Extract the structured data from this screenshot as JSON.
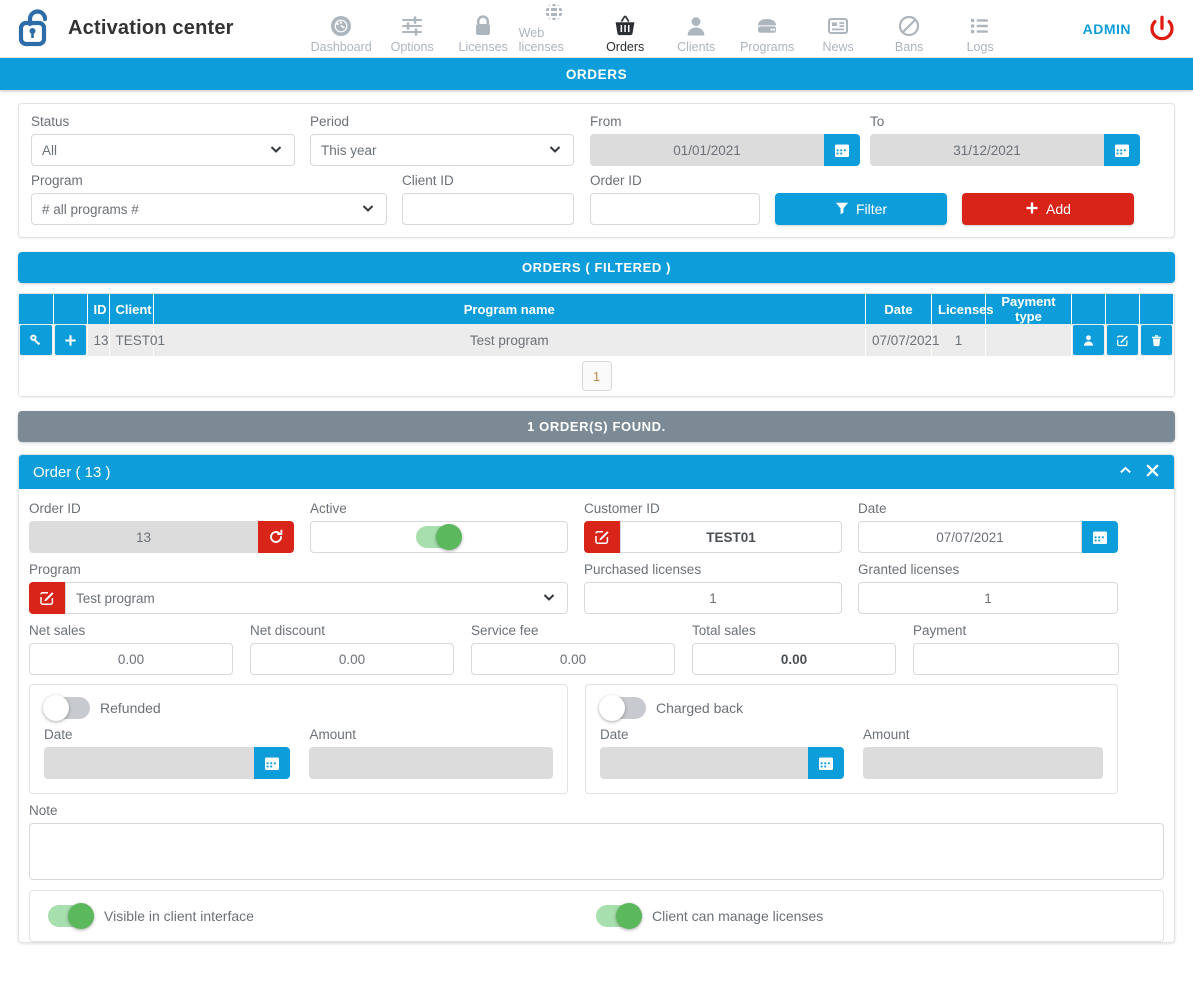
{
  "app": {
    "title": "Activation center",
    "logo_icon": "open-padlock-icon",
    "admin_label": "ADMIN",
    "power_icon": "power-icon"
  },
  "nav": {
    "items": [
      {
        "label": "Dashboard",
        "icon": "dashboard-gauge-icon",
        "active": false
      },
      {
        "label": "Options",
        "icon": "sliders-icon",
        "active": false
      },
      {
        "label": "Licenses",
        "icon": "lock-icon",
        "active": false
      },
      {
        "label": "Web licenses",
        "icon": "globe-icon",
        "active": false
      },
      {
        "label": "Orders",
        "icon": "basket-icon",
        "active": true
      },
      {
        "label": "Clients",
        "icon": "user-icon",
        "active": false
      },
      {
        "label": "Programs",
        "icon": "server-icon",
        "active": false
      },
      {
        "label": "News",
        "icon": "newspaper-icon",
        "active": false
      },
      {
        "label": "Bans",
        "icon": "ban-icon",
        "active": false
      },
      {
        "label": "Logs",
        "icon": "list-icon",
        "active": false
      }
    ]
  },
  "page_banner": {
    "title": "ORDERS"
  },
  "filters": {
    "status": {
      "label": "Status",
      "value": "All"
    },
    "period": {
      "label": "Period",
      "value": "This year"
    },
    "from": {
      "label": "From",
      "value": "01/01/2021",
      "calendar_icon": "calendar-icon"
    },
    "to": {
      "label": "To",
      "value": "31/12/2021",
      "calendar_icon": "calendar-icon"
    },
    "program": {
      "label": "Program",
      "value": "# all programs #"
    },
    "client_id": {
      "label": "Client ID",
      "value": ""
    },
    "order_id": {
      "label": "Order ID",
      "value": ""
    },
    "filter_button": {
      "label": "Filter",
      "icon": "funnel-icon",
      "color": "#0d9ddb"
    },
    "add_button": {
      "label": "Add",
      "icon": "plus-icon",
      "color": "#d9241a"
    }
  },
  "results": {
    "header": "ORDERS ( FILTERED )",
    "found_bar": "1 ORDER(S) FOUND.",
    "columns": [
      "",
      "",
      "ID",
      "Client",
      "Program name",
      "Date",
      "Licenses",
      "Payment type",
      "",
      "",
      ""
    ],
    "rows": [
      {
        "key_icon": "key-icon",
        "plus_icon": "plus-icon",
        "id": "13",
        "client": "TEST01",
        "program_name": "Test program",
        "date": "07/07/2021",
        "licenses": "1",
        "payment_type": "",
        "user_icon": "user-icon",
        "edit_icon": "edit-icon",
        "delete_icon": "trash-icon"
      }
    ],
    "pagination": {
      "pages": [
        "1"
      ],
      "current": "1"
    }
  },
  "order_panel": {
    "title": "Order ( 13 )",
    "collapse_icon": "chevron-up-icon",
    "close_icon": "close-icon",
    "fields": {
      "order_id": {
        "label": "Order ID",
        "value": "13",
        "refresh_icon": "refresh-icon"
      },
      "active": {
        "label": "Active",
        "on": true
      },
      "customer_id": {
        "label": "Customer ID",
        "value": "TEST01",
        "edit_icon": "edit-icon"
      },
      "date": {
        "label": "Date",
        "value": "07/07/2021",
        "calendar_icon": "calendar-icon"
      },
      "program": {
        "label": "Program",
        "value": "Test program",
        "edit_icon": "edit-icon"
      },
      "purchased_licenses": {
        "label": "Purchased licenses",
        "value": "1"
      },
      "granted_licenses": {
        "label": "Granted licenses",
        "value": "1"
      },
      "net_sales": {
        "label": "Net sales",
        "value": "0.00"
      },
      "net_discount": {
        "label": "Net discount",
        "value": "0.00"
      },
      "service_fee": {
        "label": "Service fee",
        "value": "0.00"
      },
      "total_sales": {
        "label": "Total sales",
        "value": "0.00"
      },
      "payment": {
        "label": "Payment",
        "value": ""
      },
      "note": {
        "label": "Note",
        "value": ""
      }
    },
    "refunded": {
      "label": "Refunded",
      "on": false,
      "date_label": "Date",
      "date_value": "",
      "calendar_icon": "calendar-icon",
      "amount_label": "Amount",
      "amount_value": ""
    },
    "charged_back": {
      "label": "Charged back",
      "on": false,
      "date_label": "Date",
      "date_value": "",
      "calendar_icon": "calendar-icon",
      "amount_label": "Amount",
      "amount_value": ""
    },
    "switches": [
      {
        "label": "Visible in client interface",
        "on": true
      },
      {
        "label": "Client can manage licenses",
        "on": true
      }
    ]
  },
  "colors": {
    "accent_blue": "#0d9ddb",
    "danger_red": "#d9241a",
    "gray_bar": "#7b8a95",
    "toggle_green": "#5cb85c"
  }
}
